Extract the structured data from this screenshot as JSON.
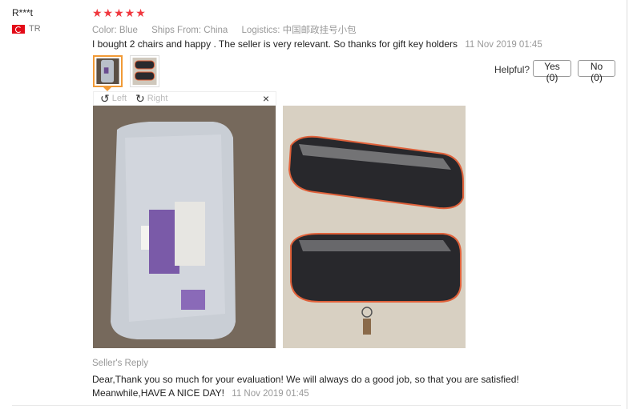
{
  "review": {
    "user_name": "R***t",
    "country_code": "TR",
    "stars": "★★★★★",
    "rating": 5,
    "color": "Color: Blue",
    "ships_from": "Ships From: China",
    "logistics": "Logistics: 中国邮政挂号小包",
    "text": "I bought 2 chairs and happy . The seller is very relevant. So thanks for gift key holders",
    "date": "11 Nov 2019 01:45"
  },
  "helpful": {
    "label": "Helpful?",
    "yes": "Yes (0)",
    "no": "No (0)"
  },
  "viewer": {
    "rotate_left": "Left",
    "rotate_right": "Right",
    "close": "×"
  },
  "seller_reply": {
    "label": "Seller's Reply",
    "line1": "Dear,Thank you so much for your evaluation! We will always do a good job, so that you are satisfied!",
    "line2": "Meanwhile,HAVE A NICE DAY!",
    "date": "11 Nov 2019 01:45"
  },
  "colors": {
    "star": "#f0373e",
    "thumb_active": "#f19a36",
    "flag": "#e30a17"
  }
}
